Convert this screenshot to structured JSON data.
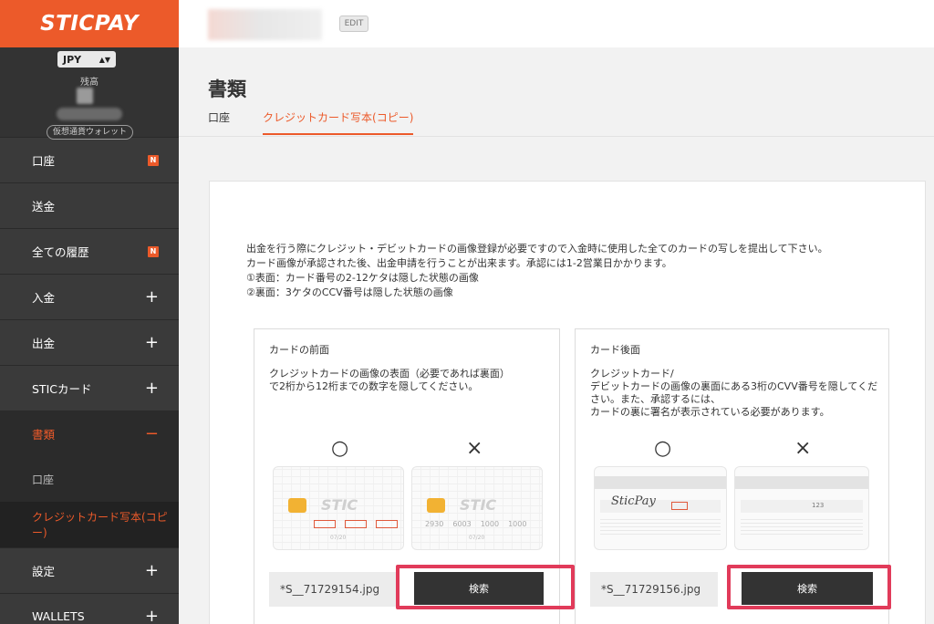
{
  "sidebar": {
    "logo": "STICPAY",
    "currency": "JPY",
    "balance_label": "残高",
    "crypto_wallet": "仮想通貨ウォレット",
    "items": [
      {
        "label": "口座",
        "badge": "N"
      },
      {
        "label": "送金"
      },
      {
        "label": "全ての履歴",
        "badge": "N"
      },
      {
        "label": "入金",
        "toggle": "+"
      },
      {
        "label": "出金",
        "toggle": "+"
      },
      {
        "label": "STICカード",
        "toggle": "+"
      },
      {
        "label": "書類",
        "toggle": "−"
      },
      {
        "label": "口座"
      },
      {
        "label": "クレジットカード写本(コピー)"
      },
      {
        "label": "設定",
        "toggle": "+"
      },
      {
        "label": "WALLETS",
        "toggle": "+"
      }
    ]
  },
  "header": {
    "edit_label": "EDIT"
  },
  "page": {
    "title": "書類",
    "tabs": [
      "口座",
      "クレジットカード写本(コピー)"
    ],
    "intro": [
      "出金を行う際にクレジット・デビットカードの画像登録が必要ですので入金時に使用した全てのカードの写しを提出して下さい。",
      "カード画像が承認された後、出金申請を行うことが出来ます。承認には1-2営業日かかります。",
      "①表面：カード番号の2-12ケタは隠した状態の画像",
      "②裏面：3ケタのCCV番号は隠した状態の画像"
    ]
  },
  "front_panel": {
    "title": "カードの前面",
    "desc": [
      "クレジットカードの画像の表面（必要であれば裏面）",
      "で2桁から12桁までの数字を隠してください。"
    ],
    "ok_mark": "○",
    "ng_mark": "×",
    "card_brand": "STIC",
    "card_last": "1000",
    "ng_numbers": [
      "2930",
      "6003",
      "1000",
      "1000"
    ],
    "expiry": "07/20",
    "file_name": "*S__71729154.jpg",
    "search_label": "検索"
  },
  "back_panel": {
    "title": "カード後面",
    "desc": [
      "クレジットカード/",
      "デビットカードの画像の裏面にある3桁のCVV番号を隠してくだ",
      "さい。また、承認するには、",
      "カードの裏に署名が表示されている必要があります。"
    ],
    "ok_mark": "○",
    "ng_mark": "×",
    "signature": "SticPay",
    "cvv": "123",
    "file_name": "*S__71729156.jpg",
    "search_label": "検索"
  },
  "colors": {
    "brand": "#ec5a2a",
    "sidebar": "#3a3a3a",
    "highlight": "#e13b5a",
    "button": "#333333"
  }
}
